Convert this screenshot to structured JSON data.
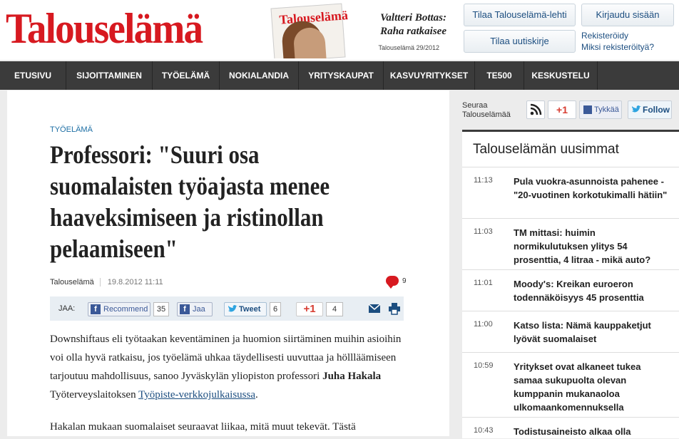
{
  "header": {
    "logo": "Talouselämä",
    "magazine_cover_title": "Talouselämä",
    "teaser_line1": "Valtteri Bottas:",
    "teaser_line2": "Raha ratkaisee",
    "issue": "Talouselämä 29/2012",
    "subscribe_magazine": "Tilaa Talouselämä-lehti",
    "subscribe_newsletter": "Tilaa uutiskirje",
    "login": "Kirjaudu sisään",
    "register": "Rekisteröidy",
    "why_register": "Miksi rekisteröityä?"
  },
  "nav": [
    "ETUSIVU",
    "SIJOITTAMINEN",
    "TYÖELÄMÄ",
    "NOKIALANDIA",
    "YRITYSKAUPAT",
    "KASVUYRITYKSET",
    "TE500",
    "KESKUSTELU"
  ],
  "article": {
    "category": "TYÖELÄMÄ",
    "title": "Professori: \"Suuri osa suomalaisten työajasta menee haaveksimiseen ja ristinollan pelaamiseen\"",
    "source": "Talouselämä",
    "date": "19.8.2012 11:11",
    "comments": "9",
    "share_label": "JAA:",
    "recommend": "Recommend",
    "recommend_count": "35",
    "share_fb": "Jaa",
    "tweet": "Tweet",
    "tweet_count": "6",
    "gplus": "+1",
    "gplus_count": "4",
    "p1_a": "Downshiftaus eli työtaakan keventäminen ja huomion siirtäminen muihin asioihin voi olla hyvä ratkaisu, jos työelämä uhkaa täydellisesti uuvuttaa ja höllläämiseen tarjoutuu mahdollisuus, sanoo Jyväskylän yliopiston professori ",
    "p1_name": "Juha Hakala",
    "p1_b": " Työterveyslaitoksen ",
    "p1_link": "Työpiste-verkkojulkaisussa",
    "p1_end": ".",
    "p2": "Hakalan mukaan suomalaiset seuraavat liikaa, mitä muut tekevät. Tästä"
  },
  "sidebar": {
    "follow_line1": "Seuraa",
    "follow_line2": "Talouselämää",
    "gplus": "+1",
    "like": "Tykkää",
    "follow": "Follow",
    "news_title": "Talouselämän uusimmat",
    "news": [
      {
        "time": "11:13",
        "text": "Pula vuokra-asunnoista pahenee - \"20-vuotinen korkotukimalli hätiin\""
      },
      {
        "time": "11:03",
        "text": "TM mittasi: huimin normikulutuksen ylitys 54 prosenttia, 4 litraa - mikä auto?"
      },
      {
        "time": "11:01",
        "text": "Moody's: Kreikan euroeron todennäköisyys 45 prosenttia"
      },
      {
        "time": "11:00",
        "text": "Katso lista: Nämä kauppaketjut lyövät suomalaiset"
      },
      {
        "time": "10:59",
        "text": "Yritykset ovat alkaneet tukea samaa sukupuolta olevan kumppanin mukanaoloa ulkomaankomennuksella"
      },
      {
        "time": "10:43",
        "text": "Todistusaineisto alkaa olla"
      }
    ]
  },
  "colors": {
    "brand_red": "#d71920",
    "nav_bg": "#3b3b3b",
    "link_blue": "#1c4e80"
  }
}
